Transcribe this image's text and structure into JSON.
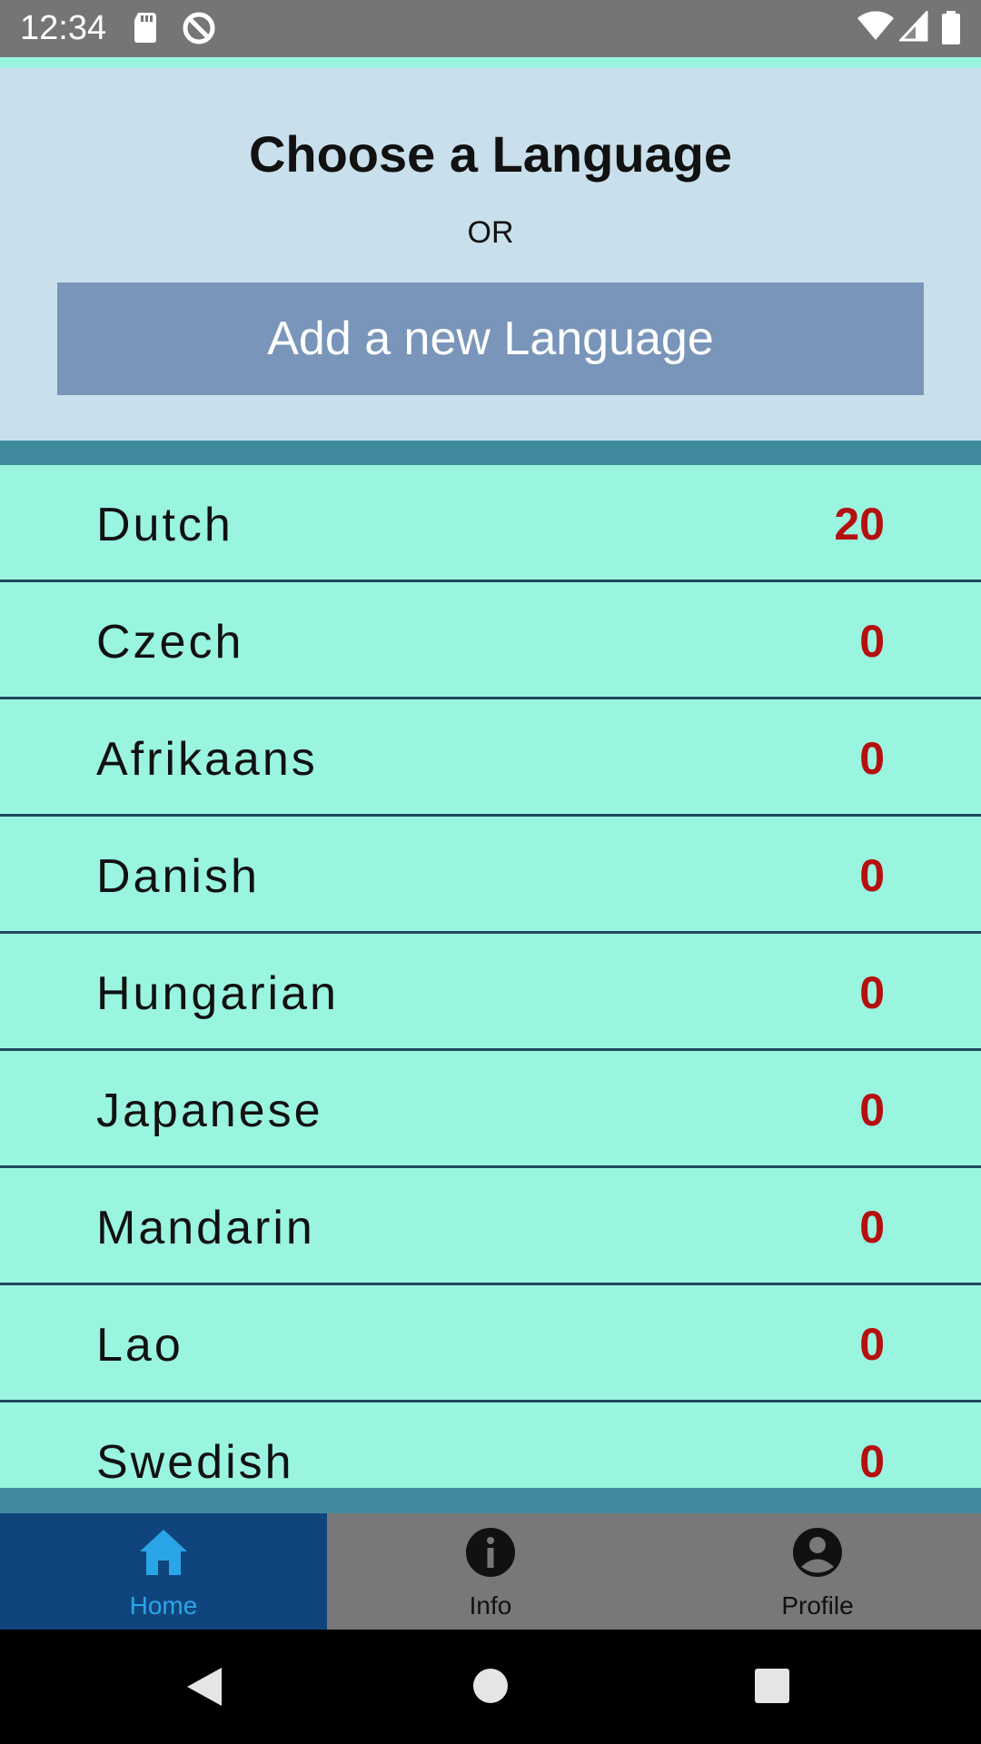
{
  "status_bar": {
    "time": "12:34"
  },
  "header": {
    "title": "Choose a Language",
    "or_text": "OR",
    "add_button_label": "Add a new Language"
  },
  "languages": [
    {
      "name": "Dutch",
      "count": "20"
    },
    {
      "name": "Czech",
      "count": "0"
    },
    {
      "name": "Afrikaans",
      "count": "0"
    },
    {
      "name": "Danish",
      "count": "0"
    },
    {
      "name": "Hungarian",
      "count": "0"
    },
    {
      "name": "Japanese",
      "count": "0"
    },
    {
      "name": "Mandarin",
      "count": "0"
    },
    {
      "name": "Lao",
      "count": "0"
    },
    {
      "name": "Swedish",
      "count": "0"
    }
  ],
  "bottom_nav": {
    "items": [
      {
        "label": "Home",
        "icon": "home-icon",
        "active": true
      },
      {
        "label": "Info",
        "icon": "info-icon",
        "active": false
      },
      {
        "label": "Profile",
        "icon": "profile-icon",
        "active": false
      }
    ]
  },
  "colors": {
    "header_bg": "#c9dfec",
    "add_button_bg": "#7995b9",
    "row_bg": "#9af5e0",
    "count_color": "#b51010",
    "nav_active_bg": "#10447c",
    "nav_active_text": "#2aa6e8"
  }
}
